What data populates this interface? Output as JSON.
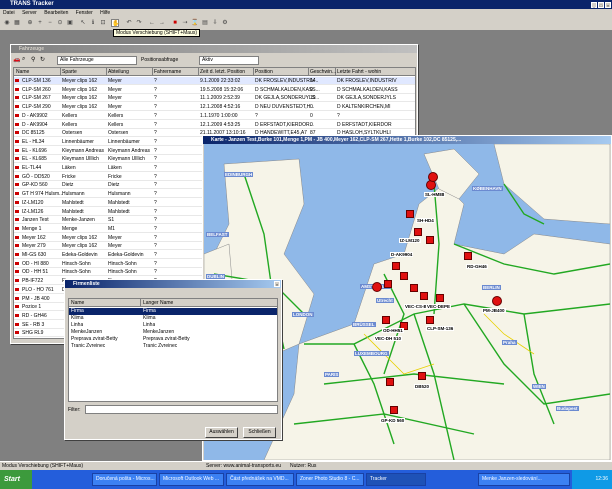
{
  "app": {
    "title": "TRANS Tracker"
  },
  "menu": [
    "Datei",
    "Server",
    "Bearbeiten",
    "Fenster",
    "Hilfe"
  ],
  "tooltip": "Modus Verschiebung (SHIFT+Maus)",
  "vehicles_window": {
    "title": "Fahrzeuge",
    "filter_value": "Alle Fahrzeuge",
    "position_label": "Positionsabfrage",
    "position_value": "Aktiv",
    "columns": [
      "Name",
      "Sparte",
      "Abteilung",
      "Fahrername",
      "Zeit d. letzt. Position",
      "Position",
      "Geschwin...",
      "Letzte Fahrt - wohin"
    ],
    "rows": [
      [
        "CLP-SM 136",
        "Meyer clips 162",
        "Meyer",
        "?",
        "9.1.2009 22:33:02",
        "DK FROSLEV,INDUSTRIV...",
        "14",
        "DK FROSLEV,INDUSTRIV"
      ],
      [
        "CLP-SM 260",
        "Meyer clips 162",
        "Meyer",
        "?",
        "19.5.2008 15:32:06",
        "D SCHMALKALDEN,KASS...",
        "0",
        "D SCHMALKALDEN,KASS"
      ],
      [
        "CLP-SM 267",
        "Meyer clips 162",
        "Meyer",
        "?",
        "11.1.2009 2:52:39",
        "DK GEJLA,SONDERUYLS...",
        "19",
        "DK GEJLA,SONDERJYLS"
      ],
      [
        "CLP-SM 290",
        "Meyer clips 162",
        "Meyer",
        "?",
        "12.1.2008 4:52:16",
        "D NEU DUVENSTEDT,H...",
        "0",
        "D KALTENKIRCHEN,MI"
      ],
      [
        "D - AK9902",
        "Kellers",
        "Kellers",
        "?",
        "1.1.1970 1:00:00",
        "?",
        "0",
        "?"
      ],
      [
        "D - AK9904",
        "Kellers",
        "Kellers",
        "?",
        "12.1.2009 4:53:25",
        "D ERFSTADT,KIERDOR...",
        "0",
        "D ERFSTADT,KIERDOR"
      ],
      [
        "DC 85125",
        "Ostersen",
        "Ostersen",
        "?",
        "21.11.2007 13:10:16",
        "D HANDEWITT,E45,A7",
        "87",
        "D HASLOH,SYLTKUHLI"
      ],
      [
        "EL - HL34",
        "Linnenbäumer",
        "Linnenbäumer",
        "?",
        "",
        "",
        "",
        ""
      ],
      [
        "EL - KL696",
        "Kleymann Andreas",
        "Kleymann Andreas",
        "?",
        "",
        "",
        "",
        ""
      ],
      [
        "EL - KL685",
        "Kleymann Ulllich",
        "Kleymann Ulllich",
        "?",
        "",
        "",
        "",
        ""
      ],
      [
        "EL-TL44",
        "Läken",
        "Läken",
        "?",
        "",
        "",
        "",
        ""
      ],
      [
        "GÖ - DD520",
        "Fricke",
        "Fricke",
        "?",
        "",
        "",
        "",
        ""
      ],
      [
        "GP-KD 560",
        "Dietz",
        "Dietz",
        "?",
        "",
        "",
        "",
        ""
      ],
      [
        "GT H 974 Hulsm...",
        "Hulsmann",
        "Hulsmann",
        "?",
        "",
        "",
        "",
        ""
      ],
      [
        "IZ-LM120",
        "Mahlstedt",
        "Mahlstedt",
        "?",
        "",
        "",
        "",
        ""
      ],
      [
        "IZ-LM126",
        "Mahlstedt",
        "Mahlstedt",
        "?",
        "",
        "",
        "",
        ""
      ],
      [
        "Janzen Test",
        "Menke-Janzen",
        "S1",
        "?",
        "",
        "",
        "",
        ""
      ],
      [
        "Menge 1",
        "Menge",
        "M1",
        "?",
        "",
        "",
        "",
        ""
      ],
      [
        "Meyer 162",
        "Meyer clips 162",
        "Meyer",
        "?",
        "",
        "",
        "",
        ""
      ],
      [
        "Meyer 279",
        "Meyer clips 162",
        "Meyer",
        "?",
        "",
        "",
        "",
        ""
      ],
      [
        "MI-GS 630",
        "Edeka-Goldevin",
        "Edeka-Goldevin",
        "?",
        "",
        "",
        "",
        ""
      ],
      [
        "OD - HI 880",
        "Hinsch-Sohn",
        "Hinsch-Sohn",
        "?",
        "",
        "",
        "",
        ""
      ],
      [
        "OD - HH 51",
        "Hinsch-Sohn",
        "Hinsch-Sohn",
        "?",
        "",
        "",
        "",
        ""
      ],
      [
        "PB-IF722",
        "Finger",
        "Finger",
        "?",
        "",
        "",
        "",
        ""
      ],
      [
        "PLO - HO 761",
        "Duggen",
        "Duggen",
        "?",
        "",
        "",
        "",
        ""
      ],
      [
        "PM - JB 400",
        "",
        "",
        "",
        "",
        "",
        "",
        ""
      ],
      [
        "Pozice 1",
        "",
        "",
        "",
        "",
        "",
        "",
        ""
      ],
      [
        "RD - GH46",
        "",
        "",
        "",
        "",
        "",
        "",
        ""
      ],
      [
        "SE - RB 3",
        "",
        "",
        "",
        "",
        "",
        "",
        ""
      ],
      [
        "SHG RL9",
        "",
        "",
        "",
        "",
        "",
        "",
        ""
      ]
    ],
    "footer": "Anzahl der Positio..."
  },
  "map_window": {
    "title": "Karte - Janzen Test,Burke 101,Menge 1,PM - JB 400,Meyer 162,CLP-SM 267,Hette 1,Burke 102,DC 85125,..."
  },
  "map_labels": {
    "cities": [
      "EDINBURGH",
      "BELFAST",
      "DUBLIN",
      "LONDON",
      "PARIS",
      "LUXEMBOURG",
      "BERLIN",
      "KØBENHAVN",
      "Praha",
      "WIEN",
      "Budapest",
      "BRÜSSEL",
      "AMSTERDAM",
      "Utrecht"
    ],
    "vehicles": [
      "SL-HM88",
      "SH-HD4",
      "IZ-LM120",
      "D-AK9904",
      "RD-GH46",
      "PM-JB400",
      "CLP-SM-136",
      "VEC-CS-BE",
      "GP-KD 560",
      "OD-HH51",
      "VEC-DH 510",
      "DB520",
      "VEC-DEPE",
      "GÖ-DD520"
    ]
  },
  "firms_dialog": {
    "title": "Firmenliste",
    "columns": [
      "Name",
      "Langer Name"
    ],
    "rows": [
      [
        "Firma",
        "Firma"
      ],
      [
        "Klima",
        "Klima"
      ],
      [
        "Linha",
        "Linha"
      ],
      [
        "MenkeJanzen",
        "MenkeJanzen"
      ],
      [
        "Preprava zvirat-Betty",
        "Preprava zvirat-Betty"
      ],
      [
        "Tranic Zvreinec",
        "Tranic Zvreinec"
      ]
    ],
    "filter_label": "Filter:",
    "ok_label": "Auswählen",
    "cancel_label": "Schließen"
  },
  "status": {
    "mode": "Modus Verschiebung (SHIFT+Maus)",
    "server": "Server: www.animal-transports.eu",
    "user": "Nutzer: Rus"
  },
  "taskbar": {
    "start": "Start",
    "tasks": [
      "Doručená pošta - Micros...",
      "Microsoft Outlook Web ...",
      "Část přednášek na VMD...",
      "Zoner Photo Studio 8 - C...",
      "Tracker",
      "Menke Janzen-sledování..."
    ],
    "clock": "12:36"
  }
}
